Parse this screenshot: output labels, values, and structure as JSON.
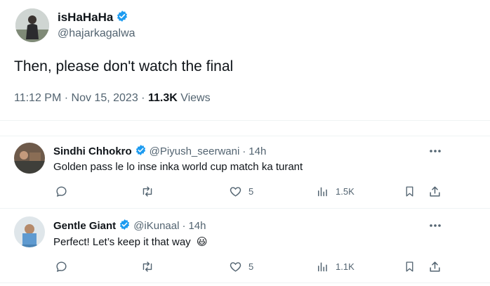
{
  "main_tweet": {
    "author_name": "isHaHaHa",
    "author_handle": "@hajarkagalwa",
    "text": "Then, please don't watch the final",
    "time": "11:12 PM",
    "separator": "·",
    "date": "Nov 15, 2023",
    "separator2": "·",
    "views_count": "11.3K",
    "views_label": "Views"
  },
  "replies": [
    {
      "author_name": "Sindhi Chhokro",
      "author_handle": "@Piyush_seerwani",
      "separator": "·",
      "time_ago": "14h",
      "text": "Golden pass le lo inse inka world cup match ka turant",
      "likes": "5",
      "views": "1.5K"
    },
    {
      "author_name": "Gentle Giant",
      "author_handle": "@iKunaal",
      "separator": "·",
      "time_ago": "14h",
      "text": "Perfect! Let’s keep it that way",
      "emoji": "😃",
      "likes": "5",
      "views": "1.1K"
    }
  ],
  "icons": {
    "verified": "verified-badge-icon",
    "more": "more-icon",
    "reply": "reply-icon",
    "retweet": "retweet-icon",
    "like": "like-icon",
    "views": "views-icon",
    "bookmark": "bookmark-icon",
    "share": "share-icon"
  },
  "colors": {
    "verified_blue": "#1d9bf0",
    "text": "#0f1419",
    "muted": "#536471",
    "divider": "#eff3f4"
  }
}
